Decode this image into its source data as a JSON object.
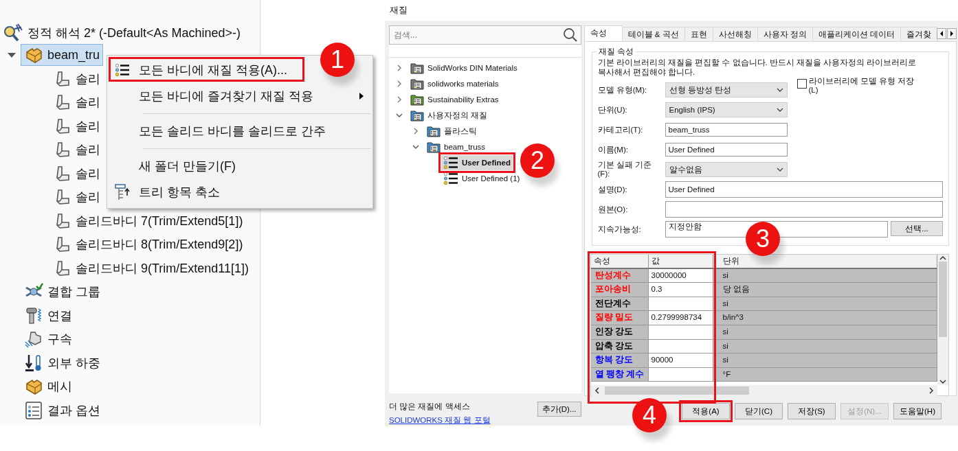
{
  "feature_tree": {
    "study": {
      "label": "정적 해석 2* (-Default<As Machined>-)",
      "children": [
        {
          "label": "beam_tru",
          "kind": "part",
          "selected": true,
          "expanded": true,
          "children": [
            {
              "label": "솔리",
              "kind": "solid-body"
            },
            {
              "label": "솔리",
              "kind": "solid-body"
            },
            {
              "label": "솔리",
              "kind": "solid-body"
            },
            {
              "label": "솔리",
              "kind": "solid-body"
            },
            {
              "label": "솔리",
              "kind": "solid-body"
            },
            {
              "label": "솔리",
              "kind": "solid-body"
            },
            {
              "label": "솔리드바디 7(Trim/Extend5[1])",
              "kind": "solid-body"
            },
            {
              "label": "솔리드바디 8(Trim/Extend9[2])",
              "kind": "solid-body"
            },
            {
              "label": "솔리드바디 9(Trim/Extend11[1])",
              "kind": "solid-body"
            }
          ]
        },
        {
          "label": "결합 그룹",
          "kind": "mates"
        },
        {
          "label": "연결",
          "kind": "connections"
        },
        {
          "label": "구속",
          "kind": "fixtures"
        },
        {
          "label": "외부 하중",
          "kind": "loads"
        },
        {
          "label": "메시",
          "kind": "mesh"
        },
        {
          "label": "결과 옵션",
          "kind": "results"
        }
      ]
    }
  },
  "context_menu": {
    "items": [
      {
        "label": "모든 바디에 재질 적용(A)...",
        "kind": "material",
        "submenu": false,
        "divider_before": false
      },
      {
        "label": "모든 바디에 즐겨찾기 재질 적용",
        "kind": "plain",
        "submenu": true,
        "divider_before": false
      },
      {
        "label": "모든 솔리드 바디를 솔리드로 간주",
        "kind": "plain",
        "submenu": false,
        "divider_before": true
      },
      {
        "label": "새 폴더 만들기(F)",
        "kind": "plain",
        "submenu": false,
        "divider_before": true
      },
      {
        "label": "트리 항목 축소",
        "kind": "collapse",
        "submenu": false,
        "divider_before": false
      }
    ]
  },
  "callouts": [
    {
      "number": "1"
    },
    {
      "number": "2"
    },
    {
      "number": "3"
    },
    {
      "number": "4"
    }
  ],
  "dialog": {
    "title": "재질",
    "search": {
      "placeholder": "검색..."
    },
    "library": {
      "items": [
        {
          "label": "SolidWorks DIN Materials",
          "kind": "folder",
          "color": "#7a7a7a",
          "expanded": false
        },
        {
          "label": "solidworks materials",
          "kind": "folder",
          "color": "#7a7a7a",
          "expanded": false
        },
        {
          "label": "Sustainability Extras",
          "kind": "folder",
          "color": "#5aa02c",
          "expanded": false
        },
        {
          "label": "사용자정의 재질",
          "kind": "folder",
          "color": "#3a8fd0",
          "expanded": true,
          "children": [
            {
              "label": "플라스틱",
              "kind": "folder",
              "color": "#3a8fd0",
              "expanded": false
            },
            {
              "label": "beam_truss",
              "kind": "folder",
              "color": "#3a8fd0",
              "expanded": true,
              "children": [
                {
                  "label": "User Defined",
                  "kind": "material",
                  "selected": true
                },
                {
                  "label": "User Defined (1)",
                  "kind": "material",
                  "selected": false
                }
              ]
            }
          ]
        }
      ]
    },
    "footer": {
      "note": "더 많은 재질에 액세스",
      "link": "SOLIDWORKS 재질 웹 포털",
      "button": "추가(D)..."
    },
    "tabs": [
      {
        "label": "속성",
        "selected": true
      },
      {
        "label": "테이블 & 곡선",
        "selected": false
      },
      {
        "label": "표현",
        "selected": false
      },
      {
        "label": "사선해칭",
        "selected": false
      },
      {
        "label": "사용자 정의",
        "selected": false
      },
      {
        "label": "애플리케이션 데이터",
        "selected": false
      },
      {
        "label": "즐겨찾",
        "selected": false
      }
    ],
    "properties": {
      "title": "재질 속성",
      "note": "기본 라이브러리의 재질을 편집할 수 없습니다. 반드시 재질을 사용자정의 라이브러리로 복사해서 편집해야 합니다.",
      "save_model_type": {
        "label": "라이브러리에 모델 유형 저장 (L)",
        "checked": false
      },
      "fields": [
        {
          "label": "모델 유형(M):",
          "kind": "dropdown",
          "value": "선형 등방성 탄성"
        },
        {
          "label": "단위(U):",
          "kind": "dropdown",
          "value": "English (IPS)"
        },
        {
          "label": "카테고리(T):",
          "kind": "text",
          "value": "beam_truss"
        },
        {
          "label": "이름(M):",
          "kind": "text",
          "value": "User Defined"
        },
        {
          "label": "기본 실패 기준(F):",
          "kind": "dropdown",
          "value": "알수없음"
        },
        {
          "label": "설명(D):",
          "kind": "wide-text",
          "value": "User Defined"
        },
        {
          "label": "원본(O):",
          "kind": "wide-text"
        },
        {
          "label": "지속가능성:",
          "kind": "text-button",
          "value": "지정안함",
          "button": "선택..."
        }
      ]
    },
    "table": {
      "columns": [
        "속성",
        "값",
        "단위"
      ],
      "rows": [
        {
          "property": "탄성계수",
          "color": "#ff0000",
          "value": "30000000",
          "unit": "si"
        },
        {
          "property": "포아송비",
          "color": "#ff0000",
          "value": "0.3",
          "unit": "당 없음"
        },
        {
          "property": "전단계수",
          "color": "#000000",
          "unit": "si"
        },
        {
          "property": "질량 밀도",
          "color": "#ff0000",
          "value": "0.2799998734",
          "unit": "b/in^3"
        },
        {
          "property": "인장 강도",
          "color": "#000000",
          "unit": "si"
        },
        {
          "property": "압축 강도",
          "color": "#000000",
          "unit": "si"
        },
        {
          "property": "항복 강도",
          "color": "#0000ff",
          "value": "90000",
          "unit": "si"
        },
        {
          "property": "열 팽창 계수",
          "color": "#0000ff",
          "unit": "°F"
        }
      ]
    },
    "buttons": [
      {
        "label": "적용(A)",
        "disabled": false
      },
      {
        "label": "닫기(C)",
        "disabled": false
      },
      {
        "label": "저장(S)",
        "disabled": false
      },
      {
        "label": "설정(N)...",
        "disabled": true
      },
      {
        "label": "도움말(H)",
        "disabled": false
      }
    ]
  }
}
